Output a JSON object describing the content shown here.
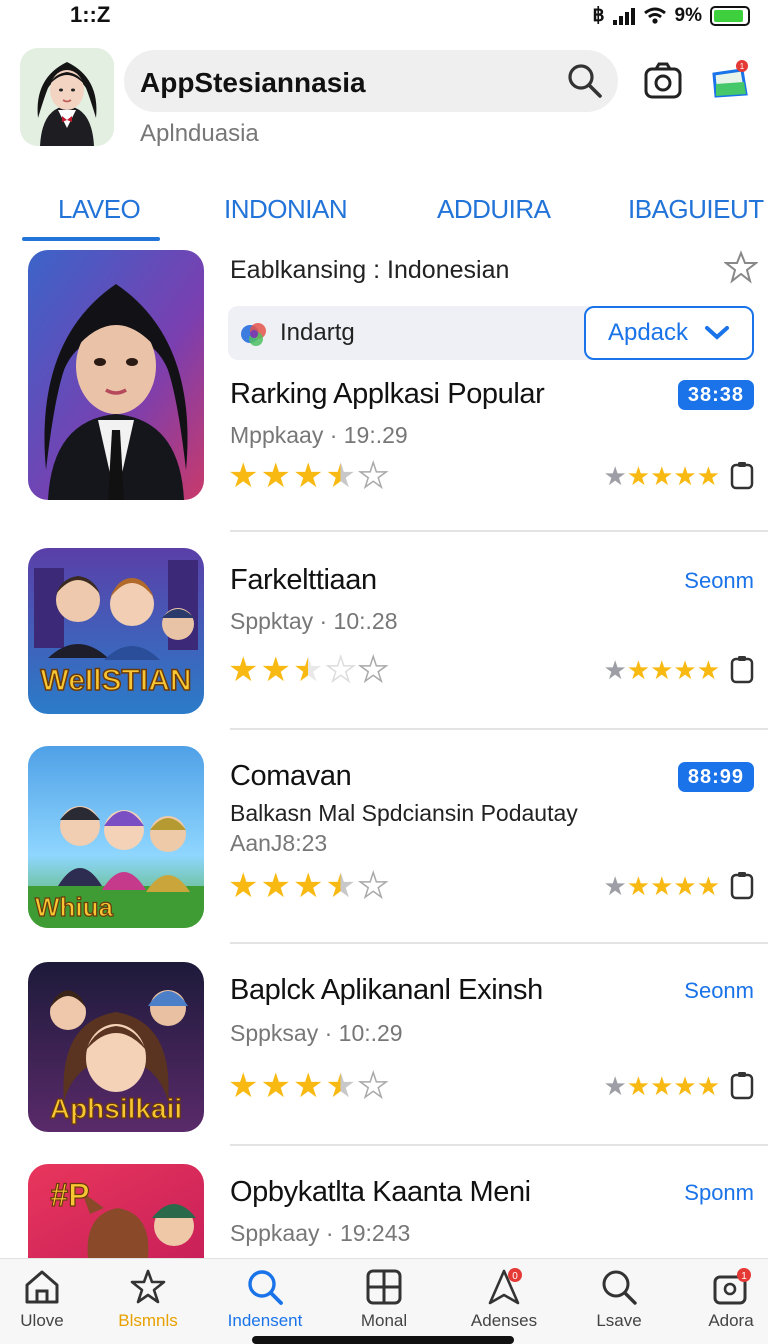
{
  "status_bar": {
    "time": "1::Z",
    "bluetooth": "฿",
    "battery_text": "9%"
  },
  "header": {
    "search_text": "AppStesiannasia",
    "subtitle": "Aplnduasia",
    "icons": [
      "avatar",
      "search-icon",
      "camera-icon",
      "panel-icon"
    ],
    "notification_dot_color": "#e53935"
  },
  "tabs": [
    {
      "label": "LAVEO",
      "active": true
    },
    {
      "label": "INDONIAN",
      "active": false
    },
    {
      "label": "ADDUIRA",
      "active": false
    },
    {
      "label": "IBAGUIEUT",
      "active": false
    }
  ],
  "featured": {
    "title": "Eablkansing : Indonesian",
    "developer": "Indartg",
    "action_label": "Apdack"
  },
  "apps": [
    {
      "title": "Rarking Applkasi Popular",
      "meta": "Mppkaay · 19:.29",
      "badge": "38:38",
      "rating": 3.5,
      "right_rating": 4
    },
    {
      "title": "Farkelttiaan",
      "meta": "Sppktay · 10:.28",
      "link": "Seonm",
      "rating": 2.5,
      "right_rating": 4
    },
    {
      "title": "Comavan",
      "desc": "Balkasn Mal Spdciansin Podautay",
      "meta": "AanJ8:23",
      "badge": "88:99",
      "rating": 3.5,
      "right_rating": 4
    },
    {
      "title": "Baplck Aplikananl Exinsh",
      "meta": "Sppksay · 10:.29",
      "link": "Seonm",
      "rating": 3.5,
      "right_rating": 4
    },
    {
      "title": "Opbykatlta Kaanta Meni",
      "meta": "Sppkaay · 19:243",
      "link": "Sponm"
    }
  ],
  "thumbnails": {
    "thumb_2_text": "WeIlSTIAN",
    "thumb_3_text": "Whiua",
    "thumb_4_text": "Aphsilkaii",
    "thumb_5_text": "#P"
  },
  "bottom_nav": [
    {
      "label": "Ulove",
      "icon": "home-icon"
    },
    {
      "label": "Blsmnls",
      "icon": "star-icon",
      "color": "#e8a000"
    },
    {
      "label": "Indensent",
      "icon": "search-icon",
      "active": true,
      "color": "#1a73e8"
    },
    {
      "label": "Monal",
      "icon": "grid-icon"
    },
    {
      "label": "Adenses",
      "icon": "bell-icon",
      "badge": "0"
    },
    {
      "label": "Lsave",
      "icon": "search-icon"
    },
    {
      "label": "Adora",
      "icon": "profile-icon",
      "badge": "1"
    }
  ]
}
